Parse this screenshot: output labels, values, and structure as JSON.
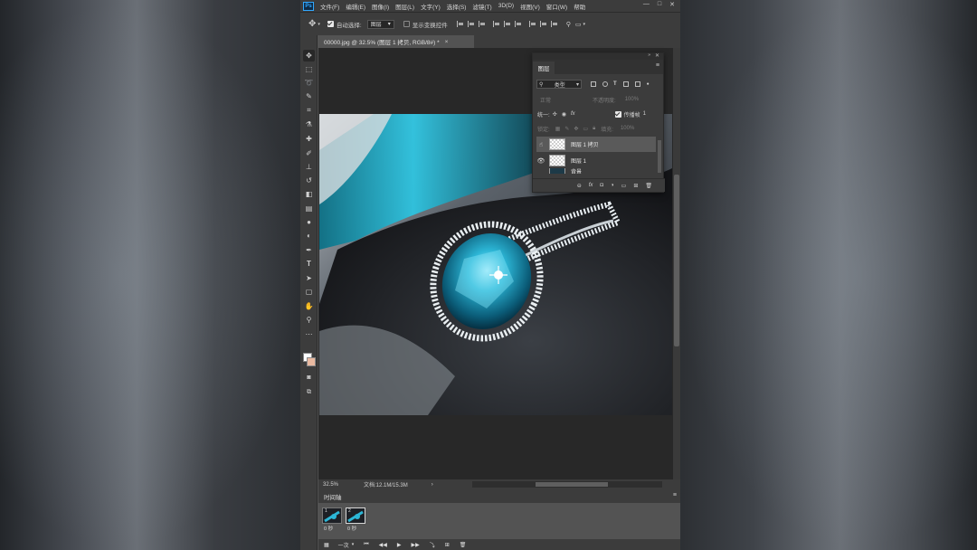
{
  "menubar": {
    "logo": "Ps",
    "items": [
      "文件(F)",
      "编辑(E)",
      "图像(I)",
      "图层(L)",
      "文字(Y)",
      "选择(S)",
      "滤镜(T)",
      "3D(D)",
      "视图(V)",
      "窗口(W)",
      "帮助"
    ],
    "minimize": "—",
    "maximize": "□",
    "close": "✕"
  },
  "options": {
    "auto_select_label": "自动选择:",
    "auto_select_value": "图层",
    "show_transform_label": "显示变换控件"
  },
  "document": {
    "tab_title": "00000.jpg @ 32.5% (图层 1 拷贝, RGB/8#) *",
    "close": "×"
  },
  "status": {
    "zoom": "32.5%",
    "doc_info": "文档:12.1M/15.3M",
    "arrow": "›"
  },
  "layers_panel": {
    "tab": "图层",
    "kind_filter": "类型",
    "blend_mode": "正常",
    "opacity_label": "不透明度:",
    "opacity_value": "100%",
    "unify_label": "统一:",
    "propagate_label": "传播帧",
    "propagate_value": "1",
    "lock_label": "锁定:",
    "fill_label": "填充:",
    "fill_value": "100%",
    "layers": [
      {
        "name": "图层 1 拷贝",
        "visible": true,
        "selected": true
      },
      {
        "name": "图层 1",
        "visible": true,
        "selected": false
      }
    ],
    "partial_layer_name": "背景",
    "footer_fx": "fx"
  },
  "timeline": {
    "title": "时间轴",
    "frames": [
      {
        "num": "1",
        "duration": "0 秒"
      },
      {
        "num": "2",
        "duration": "0 秒"
      }
    ],
    "loop": "一次"
  },
  "colors": {
    "ui_dark": "#3c3c3c",
    "ui_mid": "#535353",
    "canvas_bg": "#282828",
    "accent_blue": "#31a8ff",
    "gem_cyan": "#1fb7d6"
  }
}
